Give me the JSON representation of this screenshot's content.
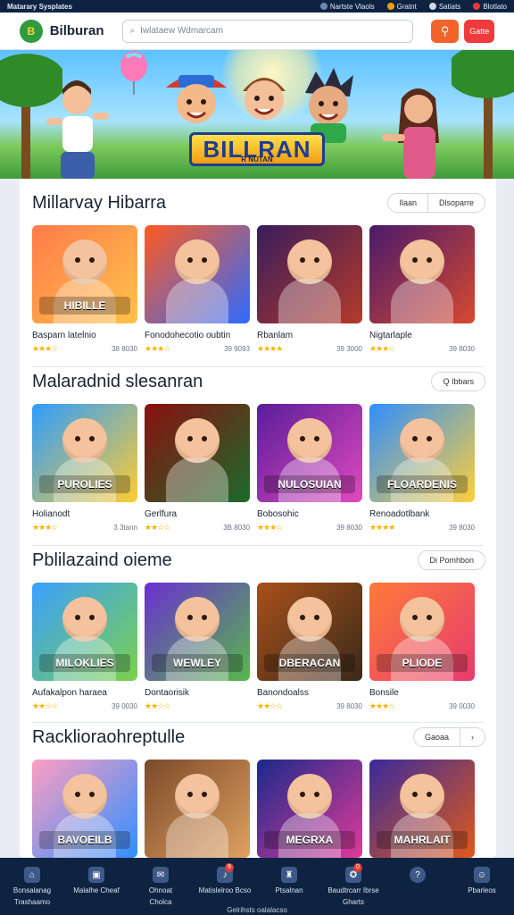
{
  "system_bar": {
    "brand": "Matarary Sysplates",
    "items": [
      "Nartste Vlaols",
      "Gratnt",
      "Satiats",
      "Blotlato"
    ]
  },
  "header": {
    "app_name": "Bilburan",
    "search_placeholder": "Iwlataew Wdmarcam",
    "login_label": "Gatte"
  },
  "banner": {
    "title": "BILLRAN",
    "subtitle": "R NUTAN"
  },
  "sections": [
    {
      "title": "Millarvay Hibarra",
      "buttons": [
        "Ilaan",
        "Dlsoparre"
      ],
      "games": [
        {
          "name": "Basparn latelnio",
          "label": "HIBILLE",
          "stars": "★★★☆",
          "plays": "38 8030",
          "colors": [
            "#ff7b4a",
            "#ffc24a"
          ]
        },
        {
          "name": "Fonodohecotio oubtin",
          "label": "",
          "stars": "★★★☆",
          "plays": "39 9093",
          "colors": [
            "#ff5a1f",
            "#2e6bff"
          ]
        },
        {
          "name": "Rbanlam",
          "label": "",
          "stars": "★★★★",
          "plays": "39 3000",
          "colors": [
            "#3a1d5c",
            "#b43a2a"
          ]
        },
        {
          "name": "Nigtarlaple",
          "label": "",
          "stars": "★★★☆",
          "plays": "39 8030",
          "colors": [
            "#4a1a6b",
            "#d6492f"
          ]
        }
      ]
    },
    {
      "title": "Malaradnid slesanran",
      "buttons": [
        "Q Ibbars"
      ],
      "games": [
        {
          "name": "Holianodt",
          "label": "PUROLIES",
          "stars": "★★★☆",
          "plays": "3 3tann",
          "colors": [
            "#2c9dff",
            "#ffcc33"
          ]
        },
        {
          "name": "Gerlfura",
          "label": "",
          "stars": "★★☆☆",
          "plays": "3B 8030",
          "colors": [
            "#8a1010",
            "#1a6b2a"
          ]
        },
        {
          "name": "Bobosohic",
          "label": "NULOSUIAN",
          "stars": "★★★☆",
          "plays": "39 8030",
          "colors": [
            "#5a1d9a",
            "#e04abf"
          ]
        },
        {
          "name": "Renoadotlbank",
          "label": "FLOARDENIS",
          "stars": "★★★★",
          "plays": "39 8030",
          "colors": [
            "#2e8fff",
            "#ffcf3a"
          ]
        }
      ]
    },
    {
      "title": "Pblilazaind oieme",
      "buttons": [
        "Di Pomhbon"
      ],
      "games": [
        {
          "name": "Aufakalpon haraea",
          "label": "MILOKLIES",
          "stars": "★★☆☆",
          "plays": "39 0030",
          "colors": [
            "#3aa0ff",
            "#7ad14a"
          ]
        },
        {
          "name": "Dontaorisik",
          "label": "WEWLEY",
          "stars": "★★☆☆",
          "plays": "",
          "colors": [
            "#6a2fd0",
            "#57b84a"
          ]
        },
        {
          "name": "Banondoalss",
          "label": "DBERACAN",
          "stars": "★★☆☆",
          "plays": "39 8030",
          "colors": [
            "#a8501a",
            "#3a2a1a"
          ]
        },
        {
          "name": "Bonsile",
          "label": "PLIODE",
          "stars": "★★★☆",
          "plays": "39 0030",
          "colors": [
            "#ff7a3a",
            "#e63b6f"
          ]
        }
      ]
    },
    {
      "title": "Racklioraohreptulle",
      "buttons": [
        "Gaoaa",
        "›"
      ],
      "games": [
        {
          "name": "",
          "label": "BAVOEILB",
          "stars": "",
          "plays": "",
          "colors": [
            "#ff9ec2",
            "#2e8fff"
          ]
        },
        {
          "name": "",
          "label": "",
          "stars": "",
          "plays": "",
          "colors": [
            "#7a4a2a",
            "#e0a060"
          ]
        },
        {
          "name": "",
          "label": "MEGRXA",
          "stars": "",
          "plays": "",
          "colors": [
            "#1a2a8a",
            "#e03a9a"
          ]
        },
        {
          "name": "",
          "label": "MAHRLAIT",
          "stars": "",
          "plays": "",
          "colors": [
            "#3a2a9a",
            "#e05a1a"
          ]
        }
      ]
    }
  ],
  "bottom_nav": [
    {
      "label": "Bonsalanag",
      "sub": "Trashaamo",
      "icon": "home-icon",
      "badge": ""
    },
    {
      "label": "Malalhe Cheaf",
      "sub": "",
      "icon": "games-icon",
      "badge": ""
    },
    {
      "label": "Ohnoat",
      "sub": "Cholca",
      "icon": "chat-icon",
      "badge": ""
    },
    {
      "label": "Matislelroo Bcso",
      "sub": "",
      "icon": "bell-icon",
      "badge": "9"
    },
    {
      "label": "Ptsalnan",
      "sub": "",
      "icon": "trophy-icon",
      "badge": ""
    },
    {
      "label": "Baudtrcarr Ibrse",
      "sub": "Gharts",
      "icon": "store-icon",
      "badge": "0"
    },
    {
      "label": "",
      "sub": "",
      "icon": "help-icon",
      "badge": ""
    },
    {
      "label": "Pbarleos",
      "sub": "",
      "icon": "profile-icon",
      "badge": ""
    }
  ],
  "bottom_caption": "Gelrihsts oalalacso"
}
